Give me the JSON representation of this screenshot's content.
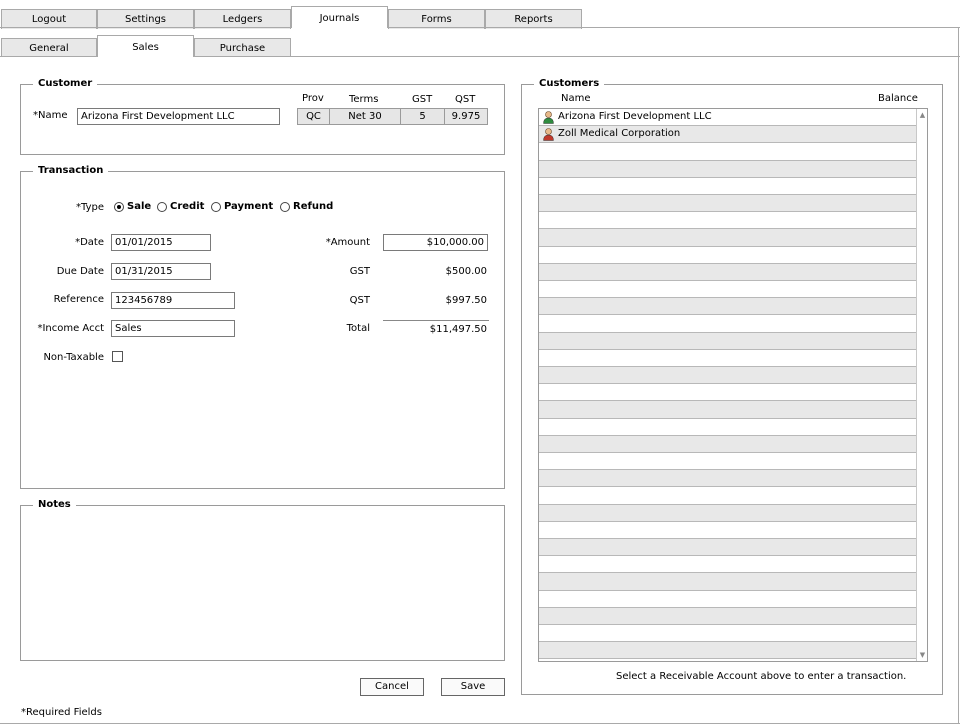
{
  "tabs": [
    "Logout",
    "Settings",
    "Ledgers",
    "Journals",
    "Forms",
    "Reports"
  ],
  "subtabs": [
    "General",
    "Sales",
    "Purchase"
  ],
  "customer": {
    "legend": "Customer",
    "name_label": "*Name",
    "name_value": "Arizona First Development LLC",
    "headers": {
      "prov": "Prov",
      "terms": "Terms",
      "gst": "GST",
      "qst": "QST"
    },
    "prov": "QC",
    "terms": "Net 30",
    "gst": "5",
    "qst": "9.975"
  },
  "transaction": {
    "legend": "Transaction",
    "type_label": "*Type",
    "types": [
      "Sale",
      "Credit",
      "Payment",
      "Refund"
    ],
    "date_label": "*Date",
    "date_value": "01/01/2015",
    "due_label": "Due Date",
    "due_value": "01/31/2015",
    "ref_label": "Reference",
    "ref_value": "123456789",
    "acct_label": "*Income Acct",
    "acct_value": "Sales",
    "nontax_label": "Non-Taxable",
    "amount_label": "*Amount",
    "amount_value": "$10,000.00",
    "gst_label": "GST",
    "gst_value": "$500.00",
    "qst_label": "QST",
    "qst_value": "$997.50",
    "total_label": "Total",
    "total_value": "$11,497.50"
  },
  "notes": {
    "legend": "Notes"
  },
  "buttons": {
    "cancel": "Cancel",
    "save": "Save"
  },
  "required_note": "*Required Fields",
  "customers": {
    "legend": "Customers",
    "col_name": "Name",
    "col_balance": "Balance",
    "rows": [
      {
        "name": "Arizona First Development LLC",
        "icon_color": "#2e8b3e"
      },
      {
        "name": "Zoll Medical Corporation",
        "icon_color": "#c0392b"
      }
    ],
    "hint": "Select a Receivable Account above to enter a transaction."
  }
}
